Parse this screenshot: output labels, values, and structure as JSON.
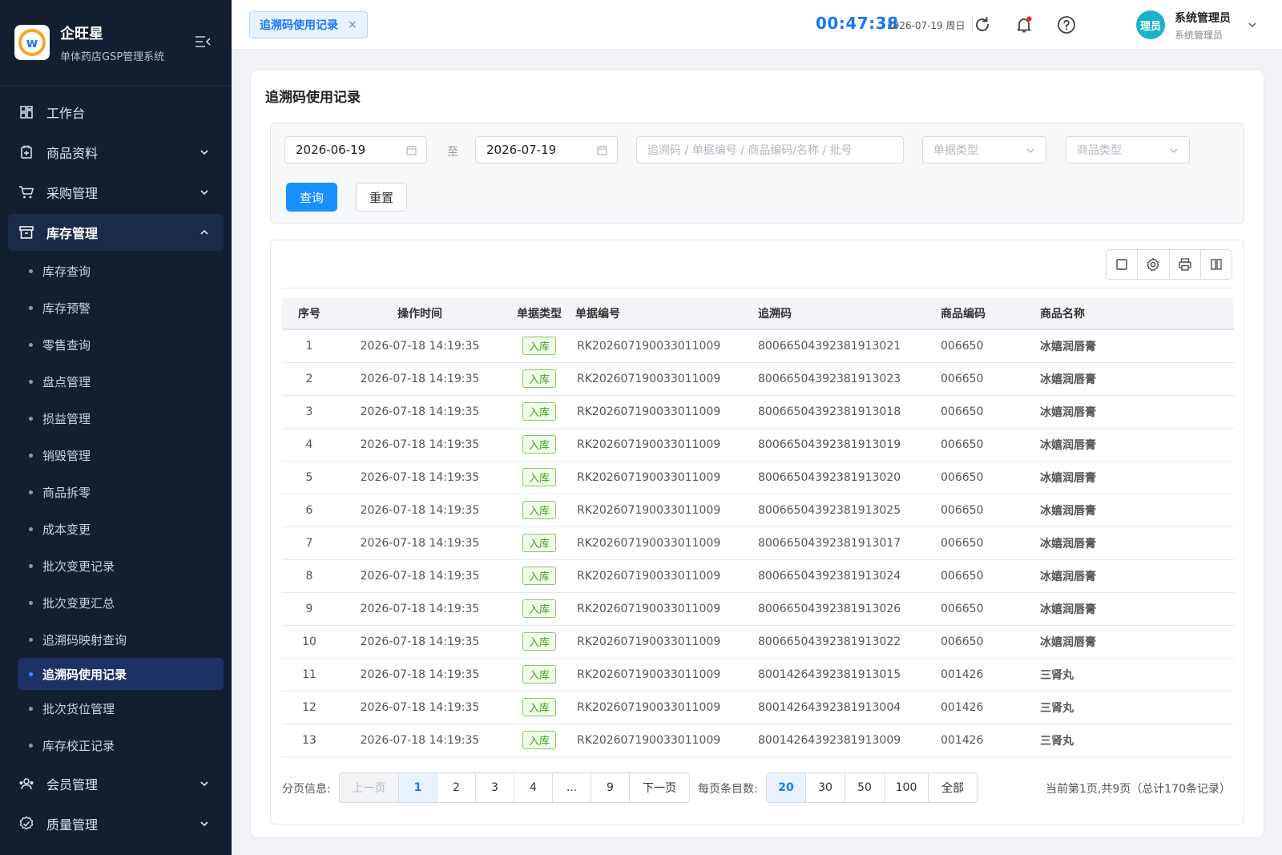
{
  "app": {
    "name": "企旺星",
    "subtitle": "单体药店GSP管理系统"
  },
  "sidebar": {
    "items": [
      {
        "label": "工作台",
        "icon": "dashboard-icon",
        "open": false,
        "chevron": false
      },
      {
        "label": "商品资料",
        "icon": "product-icon",
        "open": false,
        "chevron": true
      },
      {
        "label": "采购管理",
        "icon": "cart-icon",
        "open": false,
        "chevron": true
      },
      {
        "label": "库存管理",
        "icon": "inventory-icon",
        "open": true,
        "chevron": true
      }
    ],
    "sub_items": [
      "库存查询",
      "库存预警",
      "零售查询",
      "盘点管理",
      "损益管理",
      "销毁管理",
      "商品拆零",
      "成本变更",
      "批次变更记录",
      "批次变更汇总",
      "追溯码映射查询",
      "追溯码使用记录",
      "批次货位管理",
      "库存校正记录"
    ],
    "active_sub": "追溯码使用记录",
    "bottom_items": [
      {
        "label": "会员管理",
        "icon": "members-icon"
      },
      {
        "label": "质量管理",
        "icon": "quality-icon"
      }
    ]
  },
  "header": {
    "tab_label": "追溯码使用记录",
    "tab_close": "×",
    "clock": "00:47:38",
    "date": "2026-07-19 周日",
    "avatar_text": "理员",
    "user_name": "系统管理员",
    "user_role": "系统管理员"
  },
  "page": {
    "title": "追溯码使用记录"
  },
  "filters": {
    "date_from": "2026-06-19",
    "to_label": "至",
    "date_to": "2026-07-19",
    "search_placeholder": "追溯码 / 单据编号 / 商品编码/名称 / 批号",
    "doc_type_placeholder": "单据类型",
    "product_type_placeholder": "商品类型",
    "query_label": "查询",
    "reset_label": "重置"
  },
  "table": {
    "columns": [
      "序号",
      "操作时间",
      "单据类型",
      "单据编号",
      "追溯码",
      "商品编码",
      "商品名称"
    ],
    "rows": [
      [
        "1",
        "2026-07-18 14:19:35",
        "入库",
        "RK202607190033011009",
        "80066504392381913021",
        "006650",
        "冰嬉润唇膏"
      ],
      [
        "2",
        "2026-07-18 14:19:35",
        "入库",
        "RK202607190033011009",
        "80066504392381913023",
        "006650",
        "冰嬉润唇膏"
      ],
      [
        "3",
        "2026-07-18 14:19:35",
        "入库",
        "RK202607190033011009",
        "80066504392381913018",
        "006650",
        "冰嬉润唇膏"
      ],
      [
        "4",
        "2026-07-18 14:19:35",
        "入库",
        "RK202607190033011009",
        "80066504392381913019",
        "006650",
        "冰嬉润唇膏"
      ],
      [
        "5",
        "2026-07-18 14:19:35",
        "入库",
        "RK202607190033011009",
        "80066504392381913020",
        "006650",
        "冰嬉润唇膏"
      ],
      [
        "6",
        "2026-07-18 14:19:35",
        "入库",
        "RK202607190033011009",
        "80066504392381913025",
        "006650",
        "冰嬉润唇膏"
      ],
      [
        "7",
        "2026-07-18 14:19:35",
        "入库",
        "RK202607190033011009",
        "80066504392381913017",
        "006650",
        "冰嬉润唇膏"
      ],
      [
        "8",
        "2026-07-18 14:19:35",
        "入库",
        "RK202607190033011009",
        "80066504392381913024",
        "006650",
        "冰嬉润唇膏"
      ],
      [
        "9",
        "2026-07-18 14:19:35",
        "入库",
        "RK202607190033011009",
        "80066504392381913026",
        "006650",
        "冰嬉润唇膏"
      ],
      [
        "10",
        "2026-07-18 14:19:35",
        "入库",
        "RK202607190033011009",
        "80066504392381913022",
        "006650",
        "冰嬉润唇膏"
      ],
      [
        "11",
        "2026-07-18 14:19:35",
        "入库",
        "RK202607190033011009",
        "80014264392381913015",
        "001426",
        "三肾丸"
      ],
      [
        "12",
        "2026-07-18 14:19:35",
        "入库",
        "RK202607190033011009",
        "80014264392381913004",
        "001426",
        "三肾丸"
      ],
      [
        "13",
        "2026-07-18 14:19:35",
        "入库",
        "RK202607190033011009",
        "80014264392381913009",
        "001426",
        "三肾丸"
      ]
    ]
  },
  "pagination": {
    "info_label": "分页信息:",
    "prev_label": "上一页",
    "pages": [
      "1",
      "2",
      "3",
      "4",
      "...",
      "9"
    ],
    "current_page": "1",
    "next_label": "下一页",
    "page_size_label": "每页条目数:",
    "page_sizes": [
      "20",
      "30",
      "50",
      "100",
      "全部"
    ],
    "current_page_size": "20",
    "summary": "当前第1页,共9页（总计170条记录）"
  },
  "colors": {
    "accent": "#1677ff",
    "sidebar_bg": "#141e33",
    "tag_green": "#3aa516"
  }
}
